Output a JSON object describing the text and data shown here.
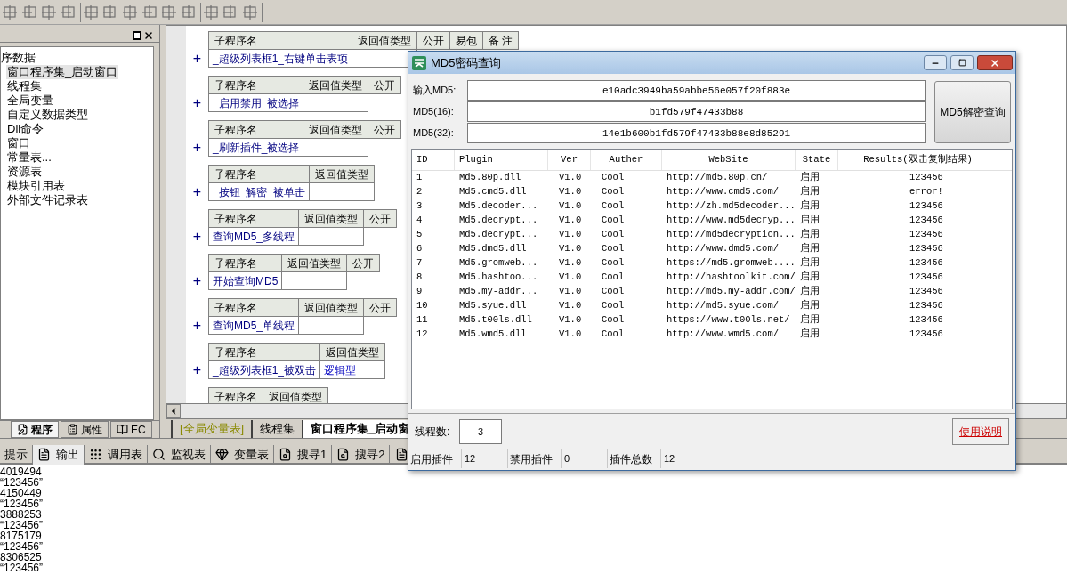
{
  "left_panel": {
    "tree": {
      "label": "序数据",
      "children": [
        {
          "label": "窗口程序集_启动窗口",
          "selected": true
        },
        {
          "label": "线程集",
          "selected": false
        },
        {
          "label": "全局变量",
          "selected": false
        },
        {
          "label": "自定义数据类型",
          "selected": false
        },
        {
          "label": "Dll命令",
          "selected": false
        },
        {
          "label": "窗口",
          "selected": false
        },
        {
          "label": "常量表...",
          "selected": false
        },
        {
          "label": "资源表",
          "selected": false
        },
        {
          "label": "模块引用表",
          "selected": false
        },
        {
          "label": "外部文件记录表",
          "selected": false
        }
      ]
    },
    "tabs": [
      {
        "label": "程序",
        "selected": true
      },
      {
        "label": "属性",
        "selected": false
      },
      {
        "label": "EC",
        "selected": false
      }
    ]
  },
  "code_panel": {
    "subroutines": [
      {
        "headers": [
          "子程序名",
          "返回值类型",
          "公开",
          "易包",
          "备 注"
        ],
        "marker": "+",
        "name": "_超级列表框1_右键单击表项"
      },
      {
        "headers": [
          "子程序名",
          "返回值类型",
          "公开"
        ],
        "marker": "+",
        "name": "_启用禁用_被选择"
      },
      {
        "headers": [
          "子程序名",
          "返回值类型",
          "公开"
        ],
        "marker": "+",
        "name": "_刷新插件_被选择"
      },
      {
        "headers": [
          "子程序名",
          "返回值类型"
        ],
        "marker": "+",
        "name": "_按钮_解密_被单击"
      },
      {
        "headers": [
          "子程序名",
          "返回值类型",
          "公开"
        ],
        "marker": "+",
        "name": "查询MD5_多线程"
      },
      {
        "headers": [
          "子程序名",
          "返回值类型",
          "公开"
        ],
        "marker": "+",
        "name": "开始查询MD5"
      },
      {
        "headers": [
          "子程序名",
          "返回值类型",
          "公开"
        ],
        "marker": "+",
        "name": "查询MD5_单线程"
      },
      {
        "headers": [
          "子程序名",
          "返回值类型"
        ],
        "marker": "+",
        "name": "_超级列表框1_被双击",
        "return_type": "逻辑型"
      },
      {
        "headers": [
          "子程序名",
          "返回值类型"
        ]
      }
    ],
    "tabs": [
      {
        "label": "[全局变量表]",
        "kind": "global",
        "selected": false
      },
      {
        "label": "线程集",
        "kind": "set",
        "selected": false
      },
      {
        "label": "窗口程序集_启动窗",
        "kind": "set",
        "selected": true
      }
    ]
  },
  "output_panel": {
    "tabs": [
      {
        "label": "提示",
        "selected": false
      },
      {
        "label": "输出",
        "selected": true
      },
      {
        "label": "调用表",
        "selected": false
      },
      {
        "label": "监视表",
        "selected": false
      },
      {
        "label": "变量表",
        "selected": false
      },
      {
        "label": "搜寻1",
        "selected": false
      },
      {
        "label": "搜寻2",
        "selected": false
      }
    ],
    "lines": [
      "4019494",
      "“123456”",
      "4150449",
      "“123456”",
      "3888253",
      "“123456”",
      "8175179",
      "“123456”",
      "8306525",
      "“123456”"
    ]
  },
  "dialog": {
    "title": "MD5密码查询",
    "fields": [
      {
        "label": "输入MD5:",
        "value": "e10adc3949ba59abbe56e057f20f883e"
      },
      {
        "label": "MD5(16):",
        "value": "b1fd579f47433b88"
      },
      {
        "label": "MD5(32):",
        "value": "14e1b600b1fd579f47433b88e8d85291"
      }
    ],
    "query_button": "MD5解密查询",
    "table": {
      "columns": [
        "ID",
        "Plugin",
        "Ver",
        "Auther",
        "WebSite",
        "State",
        "Results(双击复制结果)"
      ],
      "rows": [
        [
          "1",
          "Md5.80p.dll",
          "V1.0",
          "Cool",
          "http://md5.80p.cn/",
          "启用",
          "123456"
        ],
        [
          "2",
          "Md5.cmd5.dll",
          "V1.0",
          "Cool",
          "http://www.cmd5.com/",
          "启用",
          "error!"
        ],
        [
          "3",
          "Md5.decoder...",
          "V1.0",
          "Cool",
          "http://zh.md5decoder...",
          "启用",
          "123456"
        ],
        [
          "4",
          "Md5.decrypt...",
          "V1.0",
          "Cool",
          "http://www.md5decryp...",
          "启用",
          "123456"
        ],
        [
          "5",
          "Md5.decrypt...",
          "V1.0",
          "Cool",
          "http://md5decryption...",
          "启用",
          "123456"
        ],
        [
          "6",
          "Md5.dmd5.dll",
          "V1.0",
          "Cool",
          "http://www.dmd5.com/",
          "启用",
          "123456"
        ],
        [
          "7",
          "Md5.gromweb...",
          "V1.0",
          "Cool",
          "https://md5.gromweb....",
          "启用",
          "123456"
        ],
        [
          "8",
          "Md5.hashtoo...",
          "V1.0",
          "Cool",
          "http://hashtoolkit.com/",
          "启用",
          "123456"
        ],
        [
          "9",
          "Md5.my-addr...",
          "V1.0",
          "Cool",
          "http://md5.my-addr.com/",
          "启用",
          "123456"
        ],
        [
          "10",
          "Md5.syue.dll",
          "V1.0",
          "Cool",
          "http://md5.syue.com/",
          "启用",
          "123456"
        ],
        [
          "11",
          "Md5.t00ls.dll",
          "V1.0",
          "Cool",
          "https://www.t00ls.net/",
          "启用",
          "123456"
        ],
        [
          "12",
          "Md5.wmd5.dll",
          "V1.0",
          "Cool",
          "http://www.wmd5.com/",
          "启用",
          "123456"
        ]
      ]
    },
    "threads": {
      "label": "线程数:",
      "value": "3"
    },
    "help_link": "使用说明",
    "status_bar": [
      {
        "label": "启用插件",
        "value": "12"
      },
      {
        "label": "禁用插件",
        "value": "0"
      },
      {
        "label": "插件总数",
        "value": "12"
      }
    ]
  }
}
